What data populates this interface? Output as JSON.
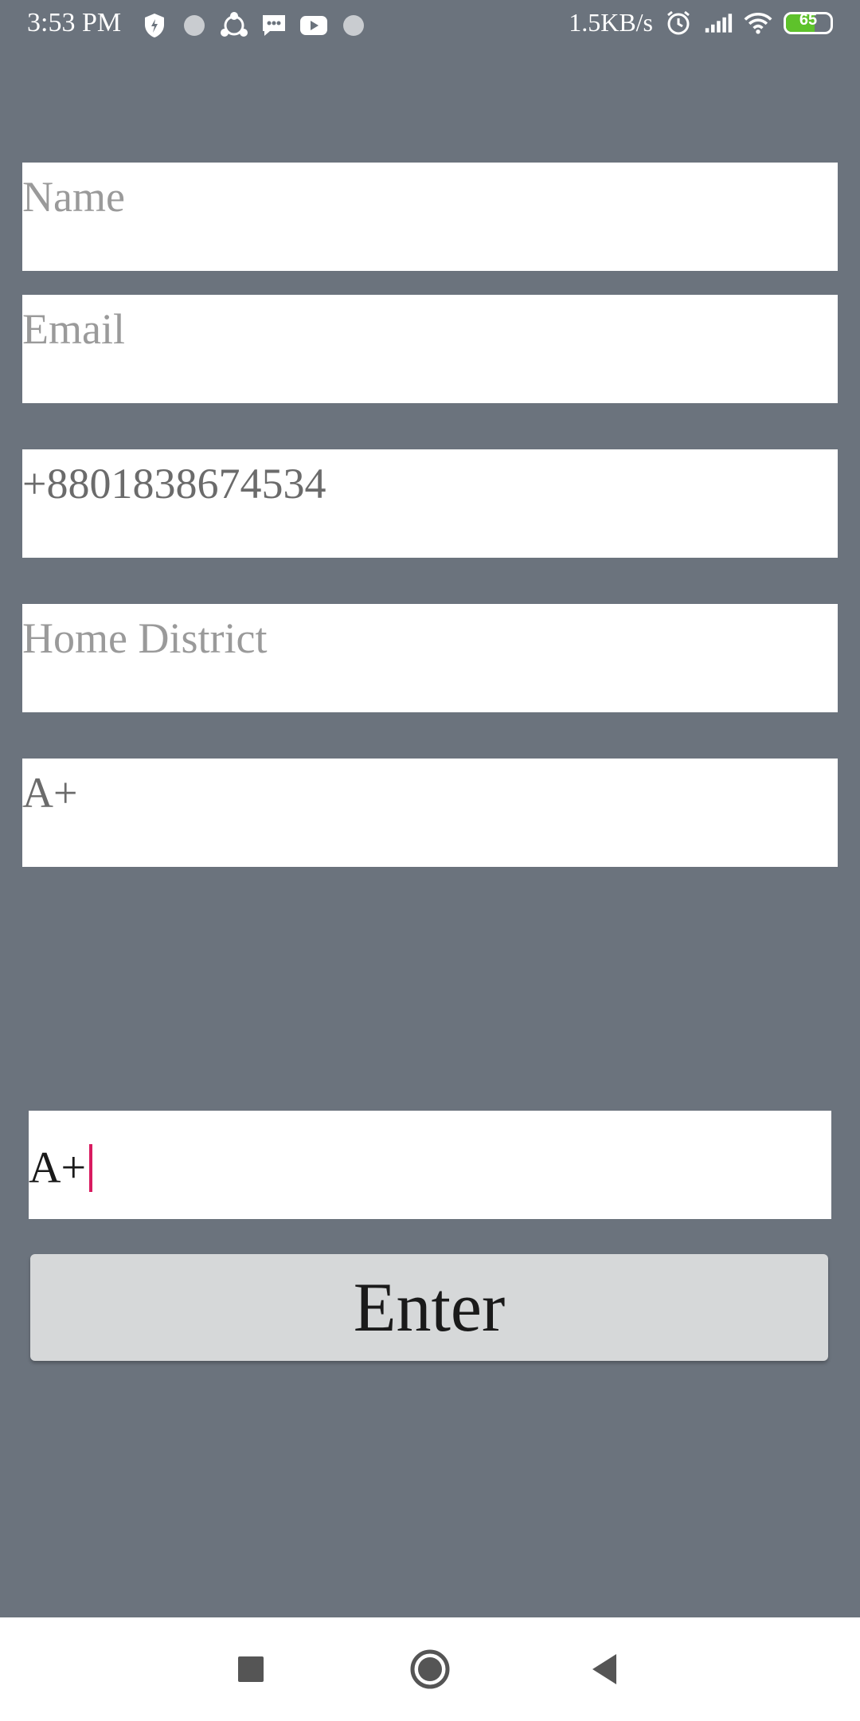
{
  "status_bar": {
    "time": "3:53 PM",
    "net_speed": "1.5KB/s",
    "battery_level": "65",
    "battery_fraction": 0.65,
    "icons_left": [
      "shield-icon",
      "app-dot-icon",
      "share-icon",
      "message-icon",
      "youtube-icon",
      "app-dot-icon"
    ],
    "icons_right": [
      "alarm-icon",
      "signal-icon",
      "wifi-icon",
      "battery-icon"
    ]
  },
  "form": {
    "name_placeholder": "Name",
    "email_placeholder": "Email",
    "phone_value": "+8801838674534",
    "district_placeholder": "Home District",
    "blood_group_value": "A+",
    "active_input_value": "A+"
  },
  "enter_label": "Enter",
  "colors": {
    "background": "#6b737d",
    "cursor": "#d81b60",
    "button": "#d6d8d9",
    "battery": "#5ec22b"
  },
  "nav_bar": {
    "icons": [
      "recent-apps-icon",
      "home-icon",
      "back-icon"
    ]
  }
}
